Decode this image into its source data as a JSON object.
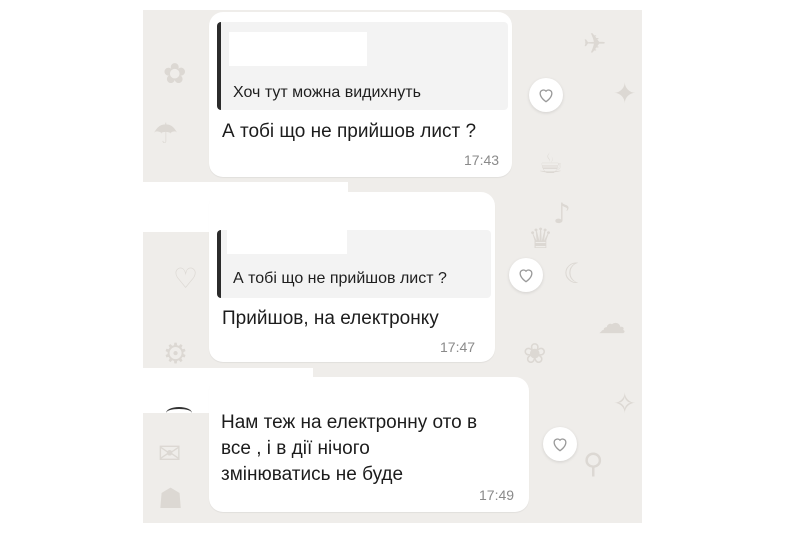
{
  "messages": [
    {
      "quote": "Хоч тут можна видихнуть",
      "text": "А тобі що не прийшов лист ?",
      "time": "17:43"
    },
    {
      "quote": "А тобі що не прийшов лист ?",
      "text": "Прийшов, на електронку",
      "time": "17:47"
    },
    {
      "text_lines": [
        "Нам теж на електронну ото в",
        "все , і в дії нічого",
        "змінюватись не буде"
      ],
      "time": "17:49"
    }
  ],
  "icons": {
    "reaction": "heart-outline-icon"
  }
}
